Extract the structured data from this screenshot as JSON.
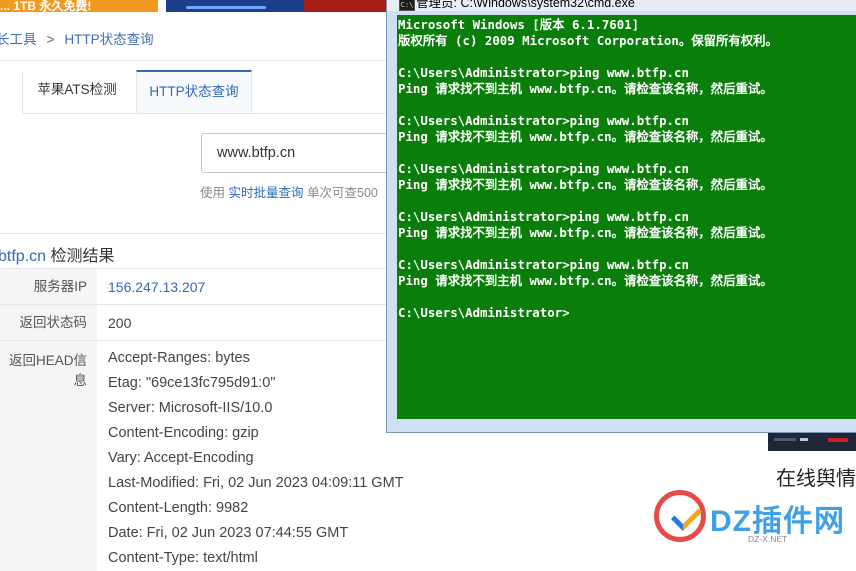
{
  "banner": {
    "left_text": "... 1TB 永久免费!"
  },
  "breadcrumb": {
    "parent": "长工具",
    "separator": ">",
    "current": "HTTP状态查询"
  },
  "tabs": [
    {
      "label": "苹果ATS检测",
      "active": false
    },
    {
      "label": "HTTP状态查询",
      "active": true
    }
  ],
  "search": {
    "value": "www.btfp.cn"
  },
  "hint": {
    "prefix": "使用",
    "link": "实时批量查询",
    "suffix": "单次可查500"
  },
  "result": {
    "domain": "btfp.cn",
    "label": "检测结果"
  },
  "rows": [
    {
      "key": "服务器IP",
      "value": "156.247.13.207"
    },
    {
      "key": "返回状态码",
      "value": "200"
    },
    {
      "key": "返回HEAD信息",
      "lines": [
        "Accept-Ranges: bytes",
        "Etag: \"69ce13fc795d91:0\"",
        "Server: Microsoft-IIS/10.0",
        "Content-Encoding: gzip",
        "Vary: Accept-Encoding",
        "Last-Modified: Fri, 02 Jun 2023 04:09:11 GMT",
        "Content-Length: 9982",
        "Date: Fri, 02 Jun 2023 07:44:55 GMT",
        "Content-Type: text/html"
      ]
    }
  ],
  "cmd": {
    "title": "管理员: C:\\Windows\\system32\\cmd.exe",
    "icon_text": "C:\\",
    "output": "Microsoft Windows [版本 6.1.7601]\n版权所有 (c) 2009 Microsoft Corporation。保留所有权利。\n\nC:\\Users\\Administrator>ping www.btfp.cn\nPing 请求找不到主机 www.btfp.cn。请检查该名称，然后重试。\n\nC:\\Users\\Administrator>ping www.btfp.cn\nPing 请求找不到主机 www.btfp.cn。请检查该名称，然后重试。\n\nC:\\Users\\Administrator>ping www.btfp.cn\nPing 请求找不到主机 www.btfp.cn。请检查该名称，然后重试。\n\nC:\\Users\\Administrator>ping www.btfp.cn\nPing 请求找不到主机 www.btfp.cn。请检查该名称，然后重试。\n\nC:\\Users\\Administrator>ping www.btfp.cn\nPing 请求找不到主机 www.btfp.cn。请检查该名称，然后重试。\n\nC:\\Users\\Administrator>"
  },
  "ad": {
    "text": "在线舆情"
  },
  "watermark": {
    "main": "DZ插件网",
    "sub": "DZ-X.NET"
  },
  "colors": {
    "cmd_bg": "#0a7e0a",
    "link": "#2e6ab8"
  }
}
